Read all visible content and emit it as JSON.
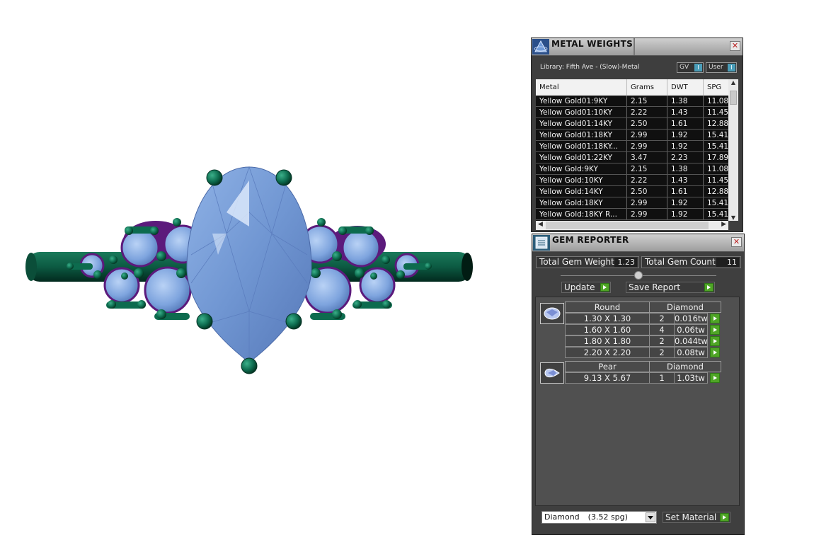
{
  "metal_weights": {
    "title": "METAL WEIGHTS",
    "library_label": "Library: Fifth Ave - (Slow)-Metal",
    "toggle_gv": "GV",
    "toggle_user": "User",
    "toggle_marker": "I",
    "close_glyph": "✕",
    "columns": [
      "Metal",
      "Grams",
      "DWT",
      "SPG"
    ],
    "rows": [
      [
        "Yellow Gold01:9KY",
        "2.15",
        "1.38",
        "11.08"
      ],
      [
        "Yellow Gold01:10KY",
        "2.22",
        "1.43",
        "11.45"
      ],
      [
        "Yellow Gold01:14KY",
        "2.50",
        "1.61",
        "12.88"
      ],
      [
        "Yellow Gold01:18KY",
        "2.99",
        "1.92",
        "15.41"
      ],
      [
        "Yellow Gold01:18KY...",
        "2.99",
        "1.92",
        "15.41"
      ],
      [
        "Yellow Gold01:22KY",
        "3.47",
        "2.23",
        "17.89"
      ],
      [
        "Yellow Gold:9KY",
        "2.15",
        "1.38",
        "11.08"
      ],
      [
        "Yellow Gold:10KY",
        "2.22",
        "1.43",
        "11.45"
      ],
      [
        "Yellow Gold:14KY",
        "2.50",
        "1.61",
        "12.88"
      ],
      [
        "Yellow Gold:18KY",
        "2.99",
        "1.92",
        "15.41"
      ],
      [
        "Yellow Gold:18KY R...",
        "2.99",
        "1.92",
        "15.41"
      ]
    ]
  },
  "gem_reporter": {
    "title": "GEM REPORTER",
    "close_glyph": "✕",
    "total_weight_label": "Total Gem Weight",
    "total_weight_value": "1.23",
    "total_count_label": "Total Gem Count",
    "total_count_value": "11",
    "update_label": "Update",
    "save_report_label": "Save Report",
    "groups": [
      {
        "shape": "Round",
        "material": "Diamond",
        "rows": [
          {
            "size": "1.30 X 1.30",
            "count": "2",
            "weight": "0.016tw"
          },
          {
            "size": "1.60 X 1.60",
            "count": "4",
            "weight": "0.06tw"
          },
          {
            "size": "1.80 X 1.80",
            "count": "2",
            "weight": "0.044tw"
          },
          {
            "size": "2.20 X 2.20",
            "count": "2",
            "weight": "0.08tw"
          }
        ]
      },
      {
        "shape": "Pear",
        "material": "Diamond",
        "rows": [
          {
            "size": "9.13 X 5.67",
            "count": "1",
            "weight": "1.03tw"
          }
        ]
      }
    ],
    "material_select": {
      "name": "Diamond",
      "spg": "(3.52 spg)"
    },
    "set_material_label": "Set Material"
  },
  "colors": {
    "gem_blue": "#7aa2dc",
    "metal_green": "#0e6b4f",
    "accent_purple": "#6a1d8a",
    "panel_bg": "#3f3f3f",
    "go_green": "#4fa526"
  }
}
